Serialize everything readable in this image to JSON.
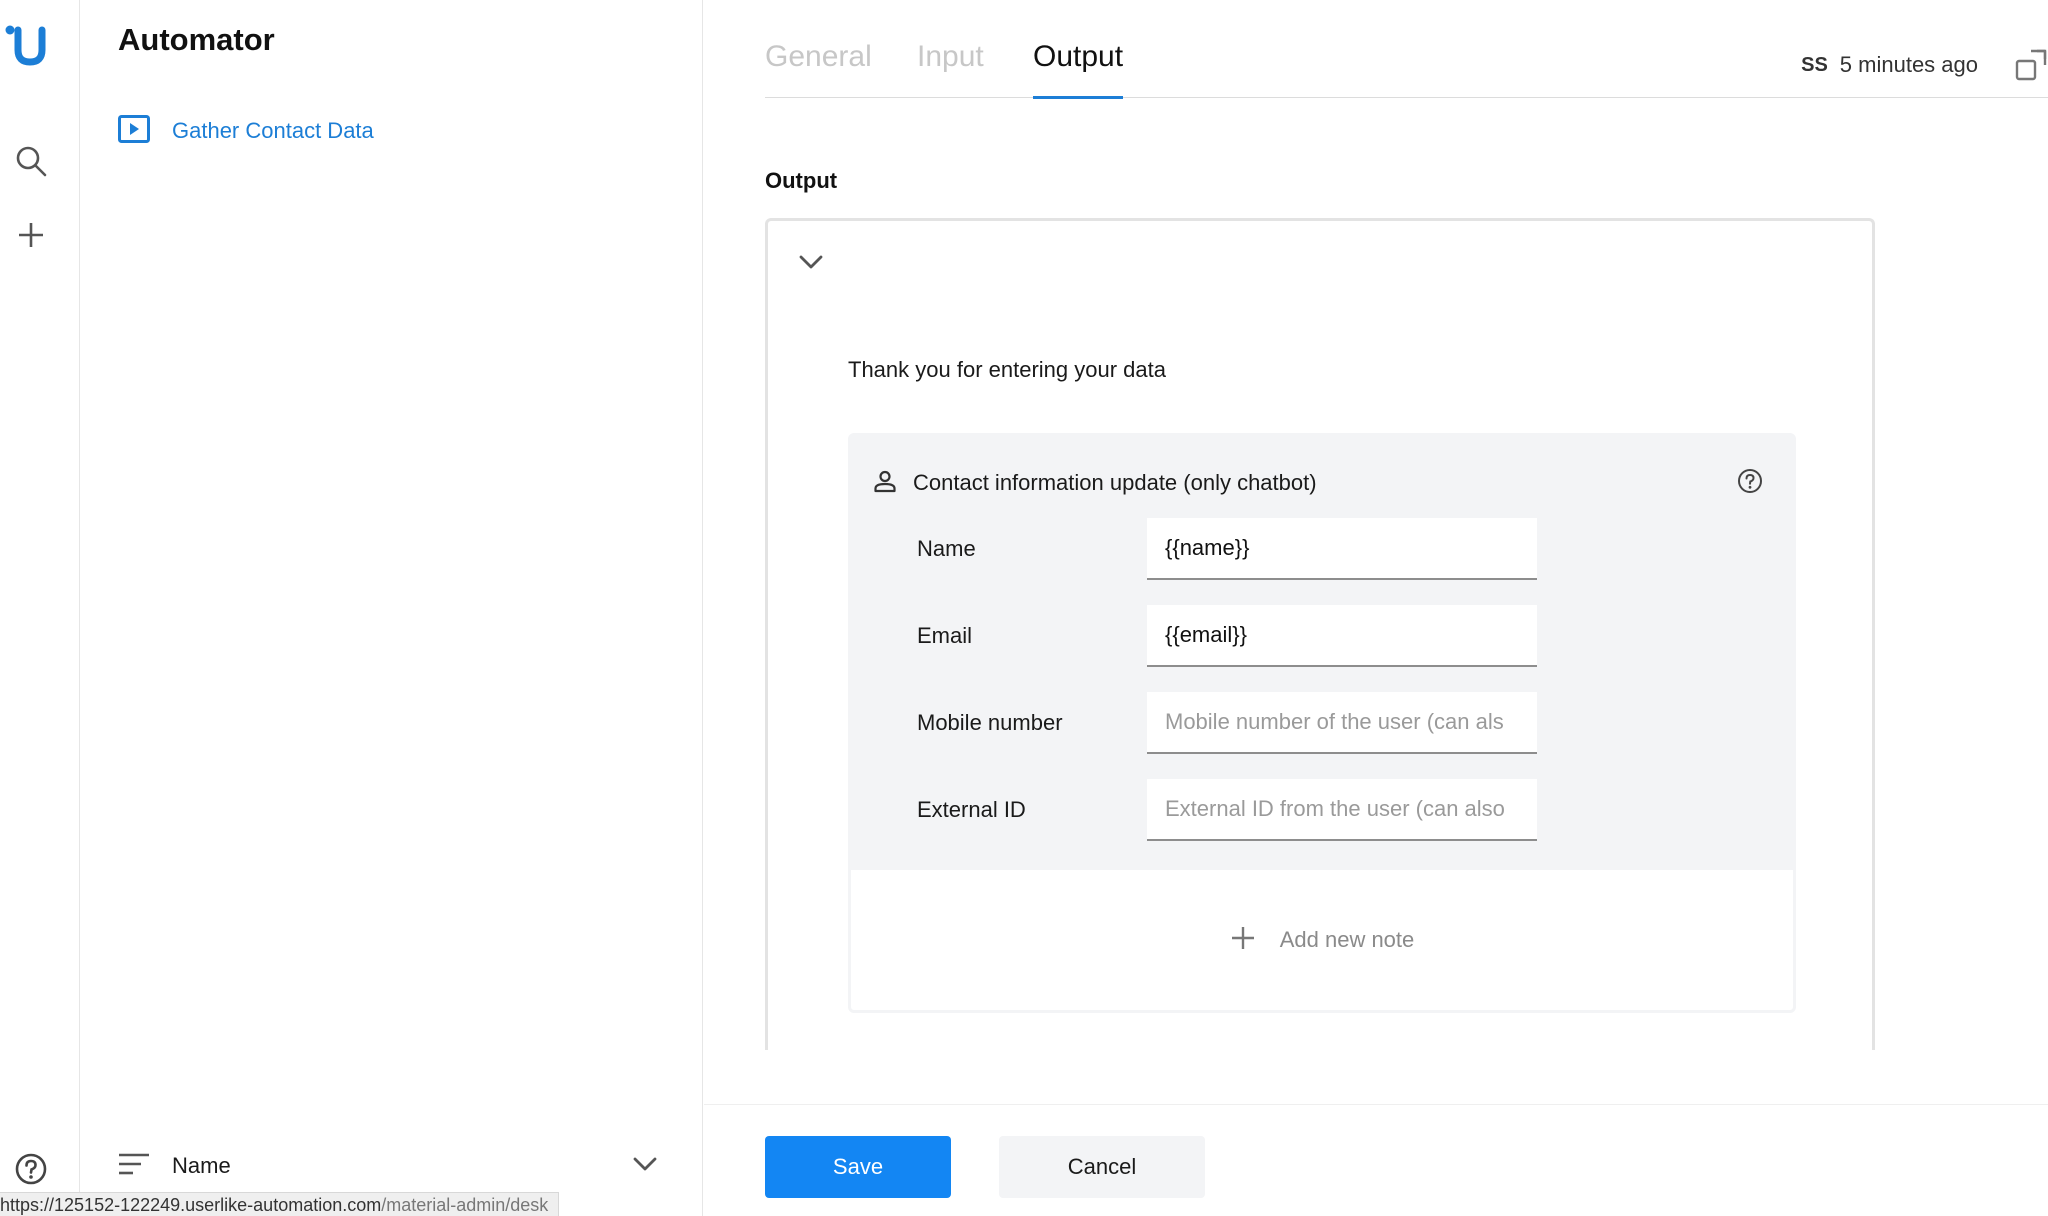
{
  "app": {
    "title": "Automator",
    "logo_icon": "userlike-logo-icon"
  },
  "rail": {
    "icons": [
      "search-icon",
      "plus-icon",
      "help-circle-icon"
    ],
    "accent": "#1c7ed6"
  },
  "sidebar": {
    "flow_item": {
      "label": "Gather Contact Data",
      "icon": "play-box-icon"
    },
    "sort": {
      "label": "Name",
      "icon": "sort-lines-icon"
    }
  },
  "status_url": {
    "host": "https://125152-122249.userlike-automation.com",
    "path": "/material-admin/desk"
  },
  "tabs": [
    {
      "label": "General",
      "active": false
    },
    {
      "label": "Input",
      "active": false
    },
    {
      "label": "Output",
      "active": true
    }
  ],
  "meta": {
    "initials": "SS",
    "time": "5 minutes ago",
    "icon": "expand-window-icon"
  },
  "output": {
    "section_title": "Output",
    "message": "Thank you for entering your data",
    "contact_block": {
      "title": "Contact information update (only chatbot)",
      "fields": [
        {
          "label": "Name",
          "value": "{{name}}",
          "placeholder": ""
        },
        {
          "label": "Email",
          "value": "{{email}}",
          "placeholder": ""
        },
        {
          "label": "Mobile number",
          "value": "",
          "placeholder": "Mobile number of the user (can als"
        },
        {
          "label": "External ID",
          "value": "",
          "placeholder": "External ID from the user (can also"
        }
      ]
    },
    "add_note_label": "Add new note"
  },
  "footer": {
    "save_label": "Save",
    "cancel_label": "Cancel"
  },
  "colors": {
    "primary": "#1386f3",
    "link": "#1c7ed6",
    "panel": "#f3f4f6"
  }
}
